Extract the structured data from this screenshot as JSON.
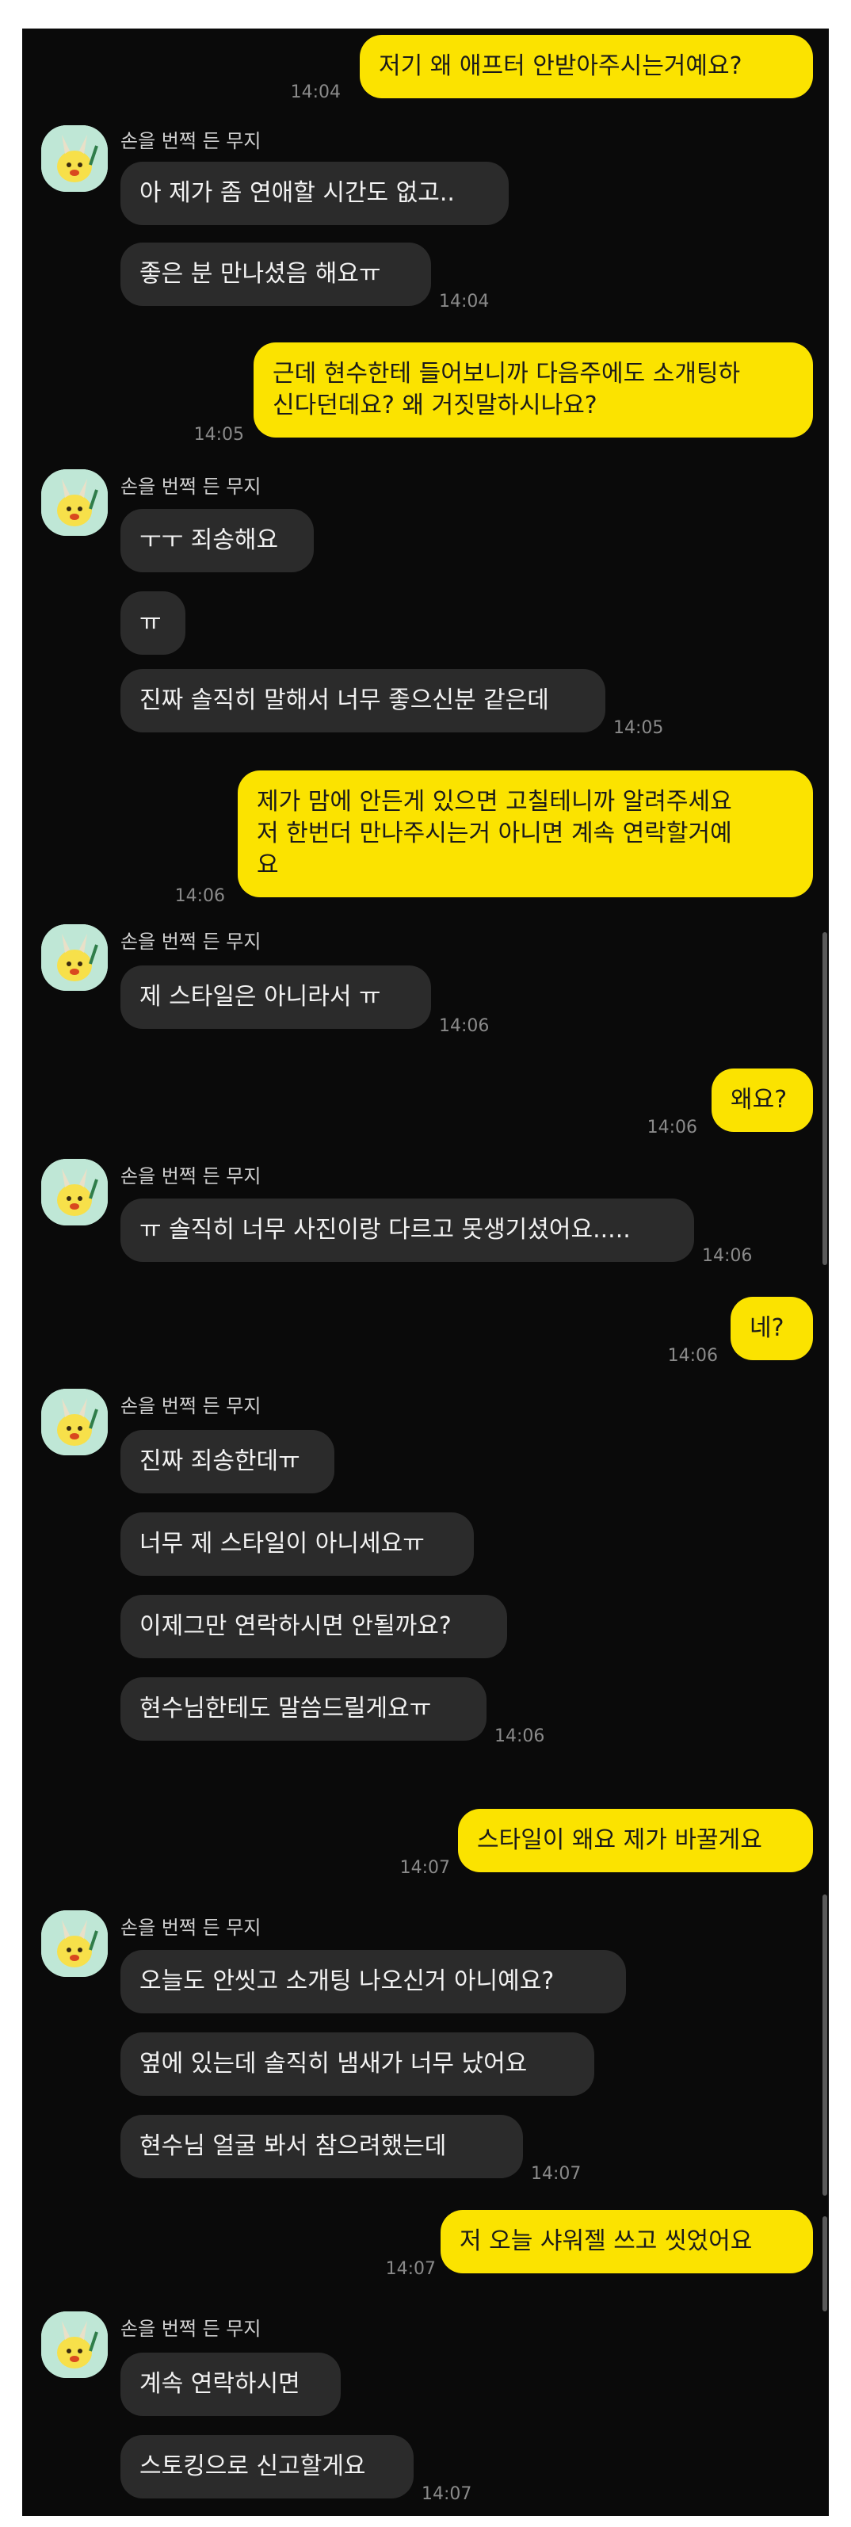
{
  "sender_name": "손을 번쩍 든 무지",
  "messages": [
    {
      "id": "m1",
      "side": "mine",
      "text": "저기 왜 애프터 안받아주시는거예요?",
      "time": "14:04"
    },
    {
      "id": "m2",
      "side": "theirs",
      "text": "아 제가 좀 연애할 시간도 없고..",
      "time": ""
    },
    {
      "id": "m3",
      "side": "theirs",
      "text": "좋은 분 만나셨음 해요ㅠ",
      "time": "14:04"
    },
    {
      "id": "m4",
      "side": "mine",
      "text": "근데 현수한테 들어보니까 다음주에도 소개팅하\n신다던데요? 왜 거짓말하시나요?",
      "time": "14:05"
    },
    {
      "id": "m5",
      "side": "theirs",
      "text": "ㅜㅜ 죄송해요",
      "time": ""
    },
    {
      "id": "m6",
      "side": "theirs",
      "text": "ㅠ",
      "time": ""
    },
    {
      "id": "m7",
      "side": "theirs",
      "text": "진짜 솔직히 말해서 너무 좋으신분 같은데",
      "time": "14:05"
    },
    {
      "id": "m8",
      "side": "mine",
      "text": "제가 맘에 안든게 있으면 고칠테니까 알려주세요\n저 한번더 만나주시는거 아니면 계속 연락할거예\n요",
      "time": "14:06"
    },
    {
      "id": "m9",
      "side": "theirs",
      "text": "제 스타일은 아니라서 ㅠ",
      "time": "14:06"
    },
    {
      "id": "m10",
      "side": "mine",
      "text": "왜요?",
      "time": "14:06"
    },
    {
      "id": "m11",
      "side": "theirs",
      "text": "ㅠ 솔직히 너무 사진이랑 다르고 못생기셨어요.....",
      "time": "14:06"
    },
    {
      "id": "m12",
      "side": "mine",
      "text": "네?",
      "time": "14:06"
    },
    {
      "id": "m13",
      "side": "theirs",
      "text": "진짜 죄송한데ㅠ",
      "time": ""
    },
    {
      "id": "m14",
      "side": "theirs",
      "text": "너무 제 스타일이 아니세요ㅠ",
      "time": ""
    },
    {
      "id": "m15",
      "side": "theirs",
      "text": "이제그만 연락하시면 안될까요?",
      "time": ""
    },
    {
      "id": "m16",
      "side": "theirs",
      "text": "현수님한테도 말씀드릴게요ㅠ",
      "time": "14:06"
    },
    {
      "id": "m17",
      "side": "mine",
      "text": "스타일이 왜요 제가 바꿀게요",
      "time": "14:07"
    },
    {
      "id": "m18",
      "side": "theirs",
      "text": "오늘도 안씻고 소개팅 나오신거 아니예요?",
      "time": ""
    },
    {
      "id": "m19",
      "side": "theirs",
      "text": "옆에 있는데 솔직히 냄새가 너무 났어요",
      "time": ""
    },
    {
      "id": "m20",
      "side": "theirs",
      "text": "현수님 얼굴 봐서 참으려했는데",
      "time": "14:07"
    },
    {
      "id": "m21",
      "side": "mine",
      "text": "저 오늘 샤워젤 쓰고 씻었어요",
      "time": "14:07"
    },
    {
      "id": "m22",
      "side": "theirs",
      "text": "계속 연락하시면",
      "time": ""
    },
    {
      "id": "m23",
      "side": "theirs",
      "text": "스토킹으로 신고할게요",
      "time": "14:07"
    }
  ],
  "colors": {
    "mine_bubble": "#fbe300",
    "theirs_bubble": "#2b2b2b",
    "background": "#0a0a0a"
  },
  "icons": {
    "avatar": "muzi-raised-hand-avatar-icon"
  }
}
